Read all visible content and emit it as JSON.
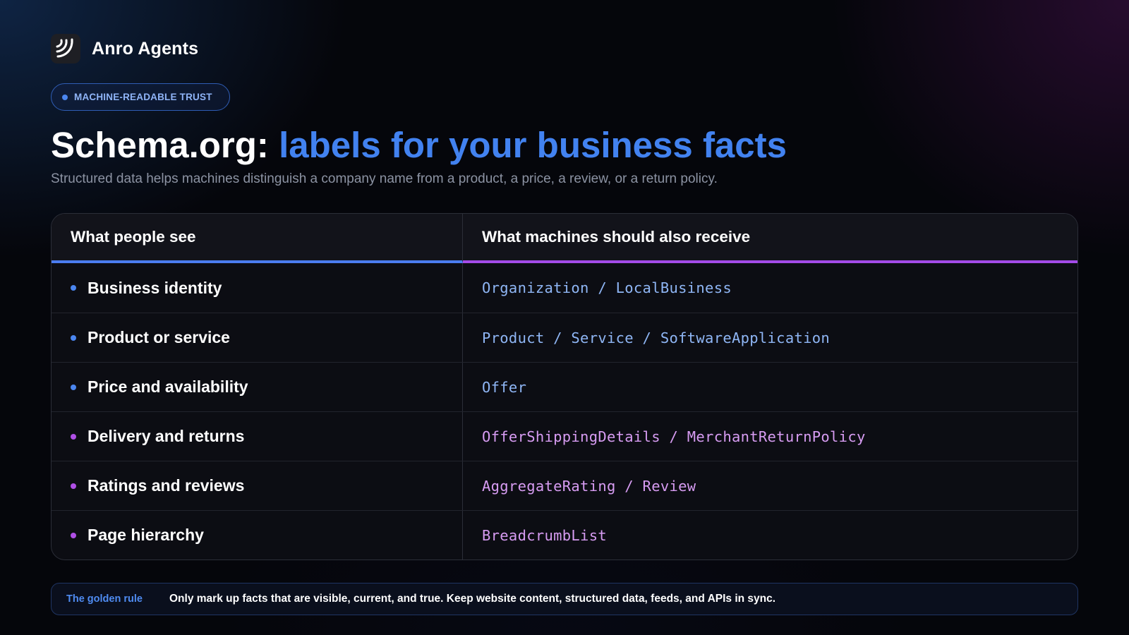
{
  "brand": {
    "name": "Anro Agents",
    "logo_icon": "swirl-logo-icon"
  },
  "badge": {
    "label": "MACHINE-READABLE TRUST",
    "dot_color": "#4b86f0"
  },
  "heading": {
    "prefix": "Schema.org: ",
    "highlight": "labels for your business facts",
    "highlight_color": "#4282f0"
  },
  "subtitle": "Structured data helps machines distinguish a company name from a product, a price, a review, or a return policy.",
  "table": {
    "columns": [
      "What people see",
      "What machines should also receive"
    ],
    "rows": [
      {
        "label": "Business identity",
        "schema": "Organization / LocalBusiness",
        "accent": "#4b86f0",
        "code_color": "#8fb6f5"
      },
      {
        "label": "Product or service",
        "schema": "Product / Service / SoftwareApplication",
        "accent": "#4b86f0",
        "code_color": "#8fb6f5"
      },
      {
        "label": "Price and availability",
        "schema": "Offer",
        "accent": "#4b86f0",
        "code_color": "#8fb6f5"
      },
      {
        "label": "Delivery and returns",
        "schema": "OfferShippingDetails / MerchantReturnPolicy",
        "accent": "#b04fe6",
        "code_color": "#d79cf2"
      },
      {
        "label": "Ratings and reviews",
        "schema": "AggregateRating / Review",
        "accent": "#b04fe6",
        "code_color": "#d79cf2"
      },
      {
        "label": "Page hierarchy",
        "schema": "BreadcrumbList",
        "accent": "#b04fe6",
        "code_color": "#d79cf2"
      }
    ]
  },
  "golden_rule": {
    "label": "The golden rule",
    "text": "Only mark up facts that are visible, current, and true. Keep website content, structured data, feeds, and APIs in sync."
  }
}
